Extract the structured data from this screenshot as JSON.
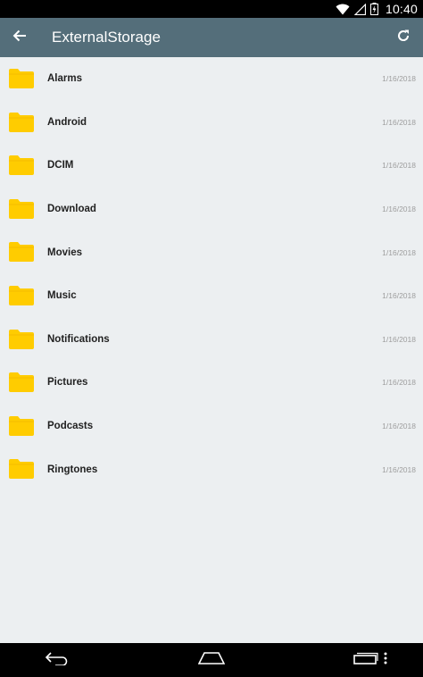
{
  "status_bar": {
    "time": "10:40"
  },
  "app_bar": {
    "title": "ExternalStorage",
    "back_icon": "arrow-left-icon",
    "refresh_icon": "refresh-icon"
  },
  "colors": {
    "app_bar": "#546e7a",
    "background": "#eceff1",
    "folder": "#ffcc00",
    "folder_tab": "#f5bd00"
  },
  "files": [
    {
      "name": "Alarms",
      "date": "1/16/2018",
      "icon": "folder-icon"
    },
    {
      "name": "Android",
      "date": "1/16/2018",
      "icon": "folder-icon"
    },
    {
      "name": "DCIM",
      "date": "1/16/2018",
      "icon": "folder-icon"
    },
    {
      "name": "Download",
      "date": "1/16/2018",
      "icon": "folder-icon"
    },
    {
      "name": "Movies",
      "date": "1/16/2018",
      "icon": "folder-icon"
    },
    {
      "name": "Music",
      "date": "1/16/2018",
      "icon": "folder-icon"
    },
    {
      "name": "Notifications",
      "date": "1/16/2018",
      "icon": "folder-icon"
    },
    {
      "name": "Pictures",
      "date": "1/16/2018",
      "icon": "folder-icon"
    },
    {
      "name": "Podcasts",
      "date": "1/16/2018",
      "icon": "folder-icon"
    },
    {
      "name": "Ringtones",
      "date": "1/16/2018",
      "icon": "folder-icon"
    }
  ],
  "nav_bar": {
    "back_icon": "nav-back-icon",
    "home_icon": "nav-home-icon",
    "recents_icon": "nav-recents-icon",
    "menu_icon": "overflow-menu-icon"
  }
}
